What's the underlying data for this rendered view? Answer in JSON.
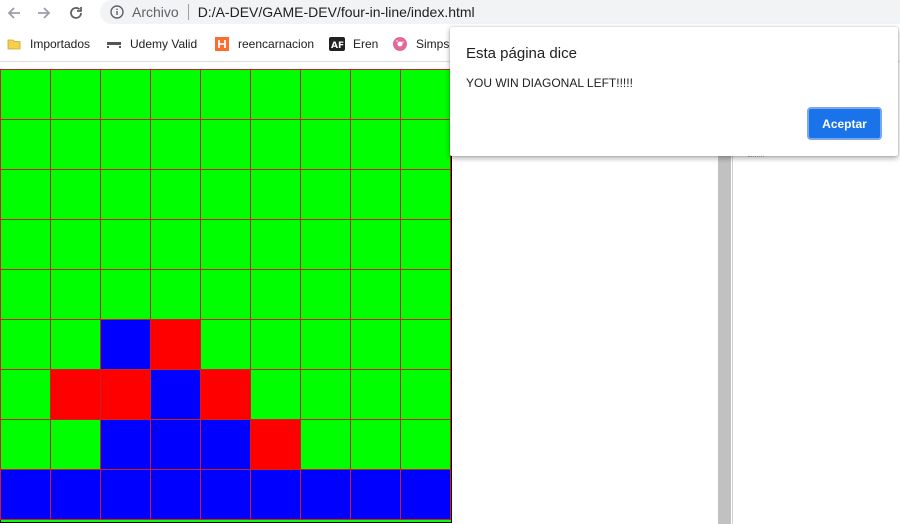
{
  "browser": {
    "scheme_label": "Archivo",
    "url": "D:/A-DEV/GAME-DEV/four-in-line/index.html",
    "nav_icons": [
      "back-arrow-icon",
      "forward-arrow-icon",
      "reload-icon",
      "info-icon"
    ]
  },
  "bookmarks": [
    {
      "label": "Importados",
      "icon": "folder-icon",
      "color": "#f9ce4a"
    },
    {
      "label": "Udemy Valid",
      "icon": "udemy-icon",
      "color": "#555555"
    },
    {
      "label": "reencarnacion",
      "icon": "h-logo-icon",
      "color": "#ff6d2e"
    },
    {
      "label": "Eren",
      "icon": "af-logo-icon",
      "color": "#222222"
    },
    {
      "label": "Simps",
      "icon": "donut-icon",
      "color": "#e26a9b"
    }
  ],
  "board": {
    "rows": 9,
    "cols": 9,
    "colors": {
      "G": "#00ff00",
      "R": "#ff0000",
      "B": "#0000ff",
      "grid": "#cc1f1f"
    },
    "cells": [
      "GGGGGGGGG",
      "GGGGGGGGG",
      "GGGGGGGGG",
      "GGGGGGGGG",
      "GGGGGGGGG",
      "GGBRGGGGG",
      "GRRBRGGGG",
      "GGBBBRGGG",
      "BBBBBBBBB"
    ]
  },
  "dialog": {
    "title": "Esta página dice",
    "message": "YOU WIN DIAGONAL LEFT!!!!!",
    "button_label": "Aceptar",
    "button_color": "#1a73e8"
  }
}
